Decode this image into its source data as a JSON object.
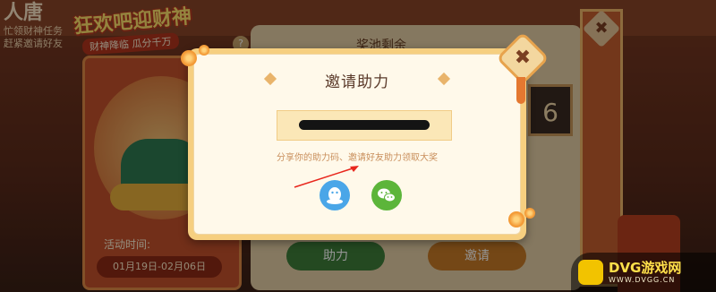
{
  "background": {
    "left_text": {
      "big": "人唐",
      "line1": "忙领财神任务",
      "line2": "赶紧邀请好友"
    },
    "title": "狂欢吧迎财神",
    "subtitle": "财神降临 瓜分千万",
    "help_badge": "?",
    "pool_title": "奖池剩余",
    "counter_digit": "6",
    "activity_label": "活动时间:",
    "activity_dates": "01月19日-02月06日",
    "btn_help": "助力",
    "btn_invite": "邀请",
    "close_glyph": "✖"
  },
  "modal": {
    "title": "邀请助力",
    "hint": "分享你的助力码、邀请好友助力领取大奖",
    "close_glyph": "✖",
    "share_qq": "qq-icon",
    "share_wechat": "wechat-icon"
  },
  "watermark": {
    "text": "DVG游戏网",
    "sub": "WWW.DVGG.CN"
  },
  "colors": {
    "accent": "#f6cf80",
    "qq": "#4aa6e8",
    "wechat": "#5cb53a",
    "arrow": "#e8261c"
  }
}
